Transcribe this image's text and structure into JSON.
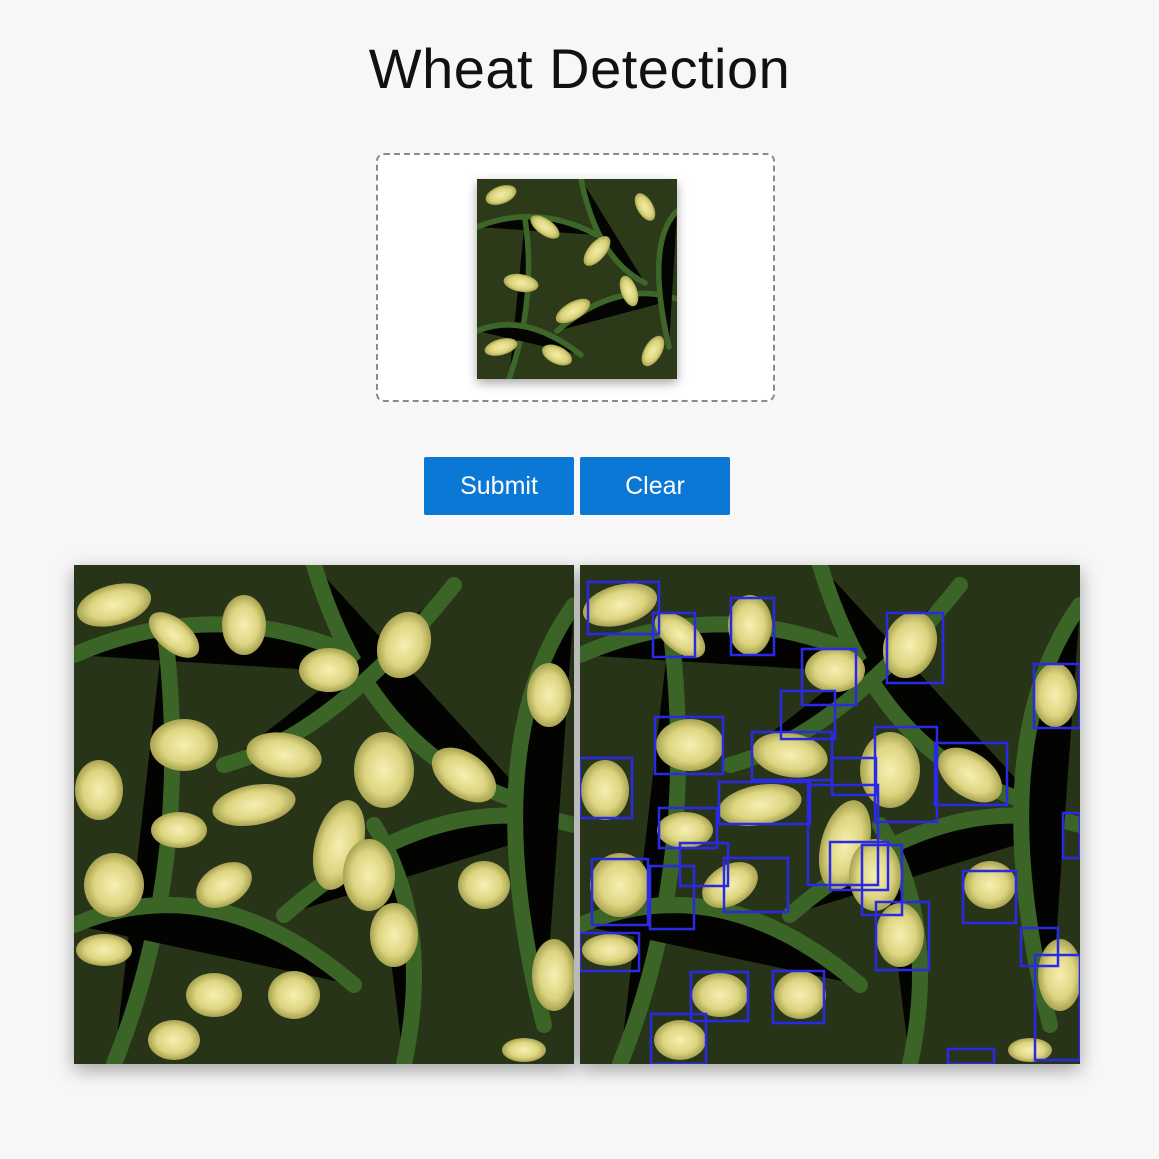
{
  "header": {
    "title": "Wheat Detection"
  },
  "actions": {
    "submit_label": "Submit",
    "clear_label": "Clear"
  },
  "colors": {
    "accent": "#0a78d4",
    "detection_box": "#2a2ae6",
    "background": "#f7f7f7"
  },
  "images": {
    "upload_preview": "wheat field thumbnail",
    "original": "wheat field photo",
    "detection": "wheat field photo with detection boxes"
  }
}
